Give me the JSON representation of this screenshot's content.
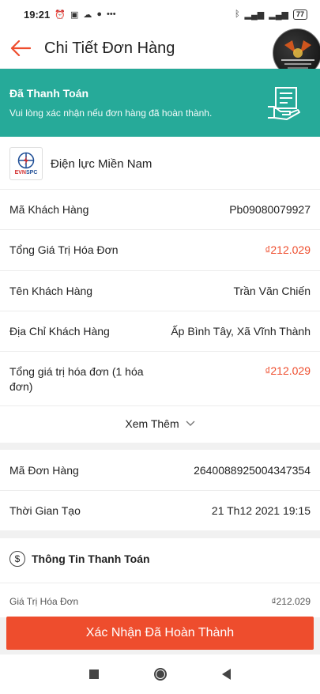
{
  "status_bar": {
    "time": "19:21",
    "battery": "77"
  },
  "header": {
    "title": "Chi Tiết Đơn Hàng"
  },
  "banner": {
    "title": "Đã Thanh Toán",
    "subtitle": "Vui lòng xác nhận nếu đơn hàng đã hoàn thành."
  },
  "provider": {
    "name": "Điện lực Miền Nam",
    "logo_text": "EVNSPC"
  },
  "details": [
    {
      "label": "Mã Khách Hàng",
      "value": "Pb09080079927"
    },
    {
      "label": "Tổng Giá Trị Hóa Đơn",
      "value": "₫212.029"
    },
    {
      "label": "Tên Khách Hàng",
      "value": "Trần Văn Chiến"
    },
    {
      "label": "Địa Chỉ Khách Hàng",
      "value": "Ấp Bình Tây, Xã Vĩnh Thành"
    },
    {
      "label": "Tổng giá trị hóa đơn (1 hóa đơn)",
      "value": "₫212.029"
    }
  ],
  "see_more": "Xem Thêm",
  "order": [
    {
      "label": "Mã Đơn Hàng",
      "value": "2640088925004347354"
    },
    {
      "label": "Thời Gian Tạo",
      "value": "21 Th12 2021 19:15"
    }
  ],
  "payment": {
    "title": "Thông Tin Thanh Toán",
    "rows": [
      {
        "label": "Giá Trị Hóa Đơn",
        "value": "₫212.029"
      }
    ]
  },
  "confirm_button": "Xác Nhận Đã Hoàn Thành",
  "colors": {
    "accent": "#ee4d2d",
    "banner": "#26aa99"
  }
}
